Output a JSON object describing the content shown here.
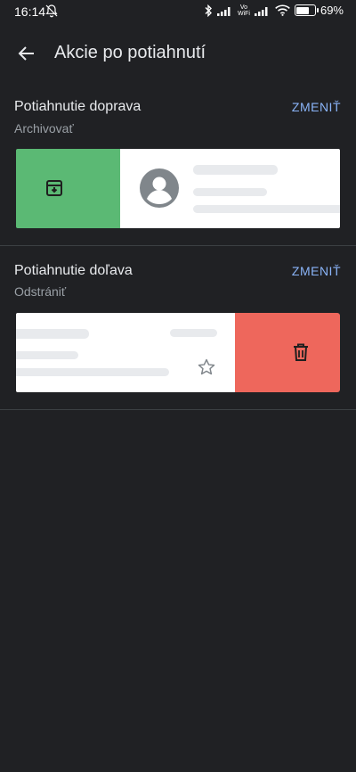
{
  "status": {
    "time": "16:14",
    "battery_text": "69%",
    "battery_level": 0.69,
    "vowifi_top": "Vo",
    "vowifi_bottom": "WiFi"
  },
  "header": {
    "title": "Akcie po potiahnutí"
  },
  "swipe_right": {
    "title": "Potiahnutie doprava",
    "action": "Archivovať",
    "change_label": "ZMENIŤ"
  },
  "swipe_left": {
    "title": "Potiahnutie doľava",
    "action": "Odstrániť",
    "change_label": "ZMENIŤ"
  },
  "colors": {
    "archive": "#5bb974",
    "delete": "#ee675c",
    "accent": "#8ab4f8"
  },
  "icons": [
    "back-arrow-icon",
    "archive-icon",
    "avatar-icon",
    "star-icon",
    "trash-icon"
  ]
}
